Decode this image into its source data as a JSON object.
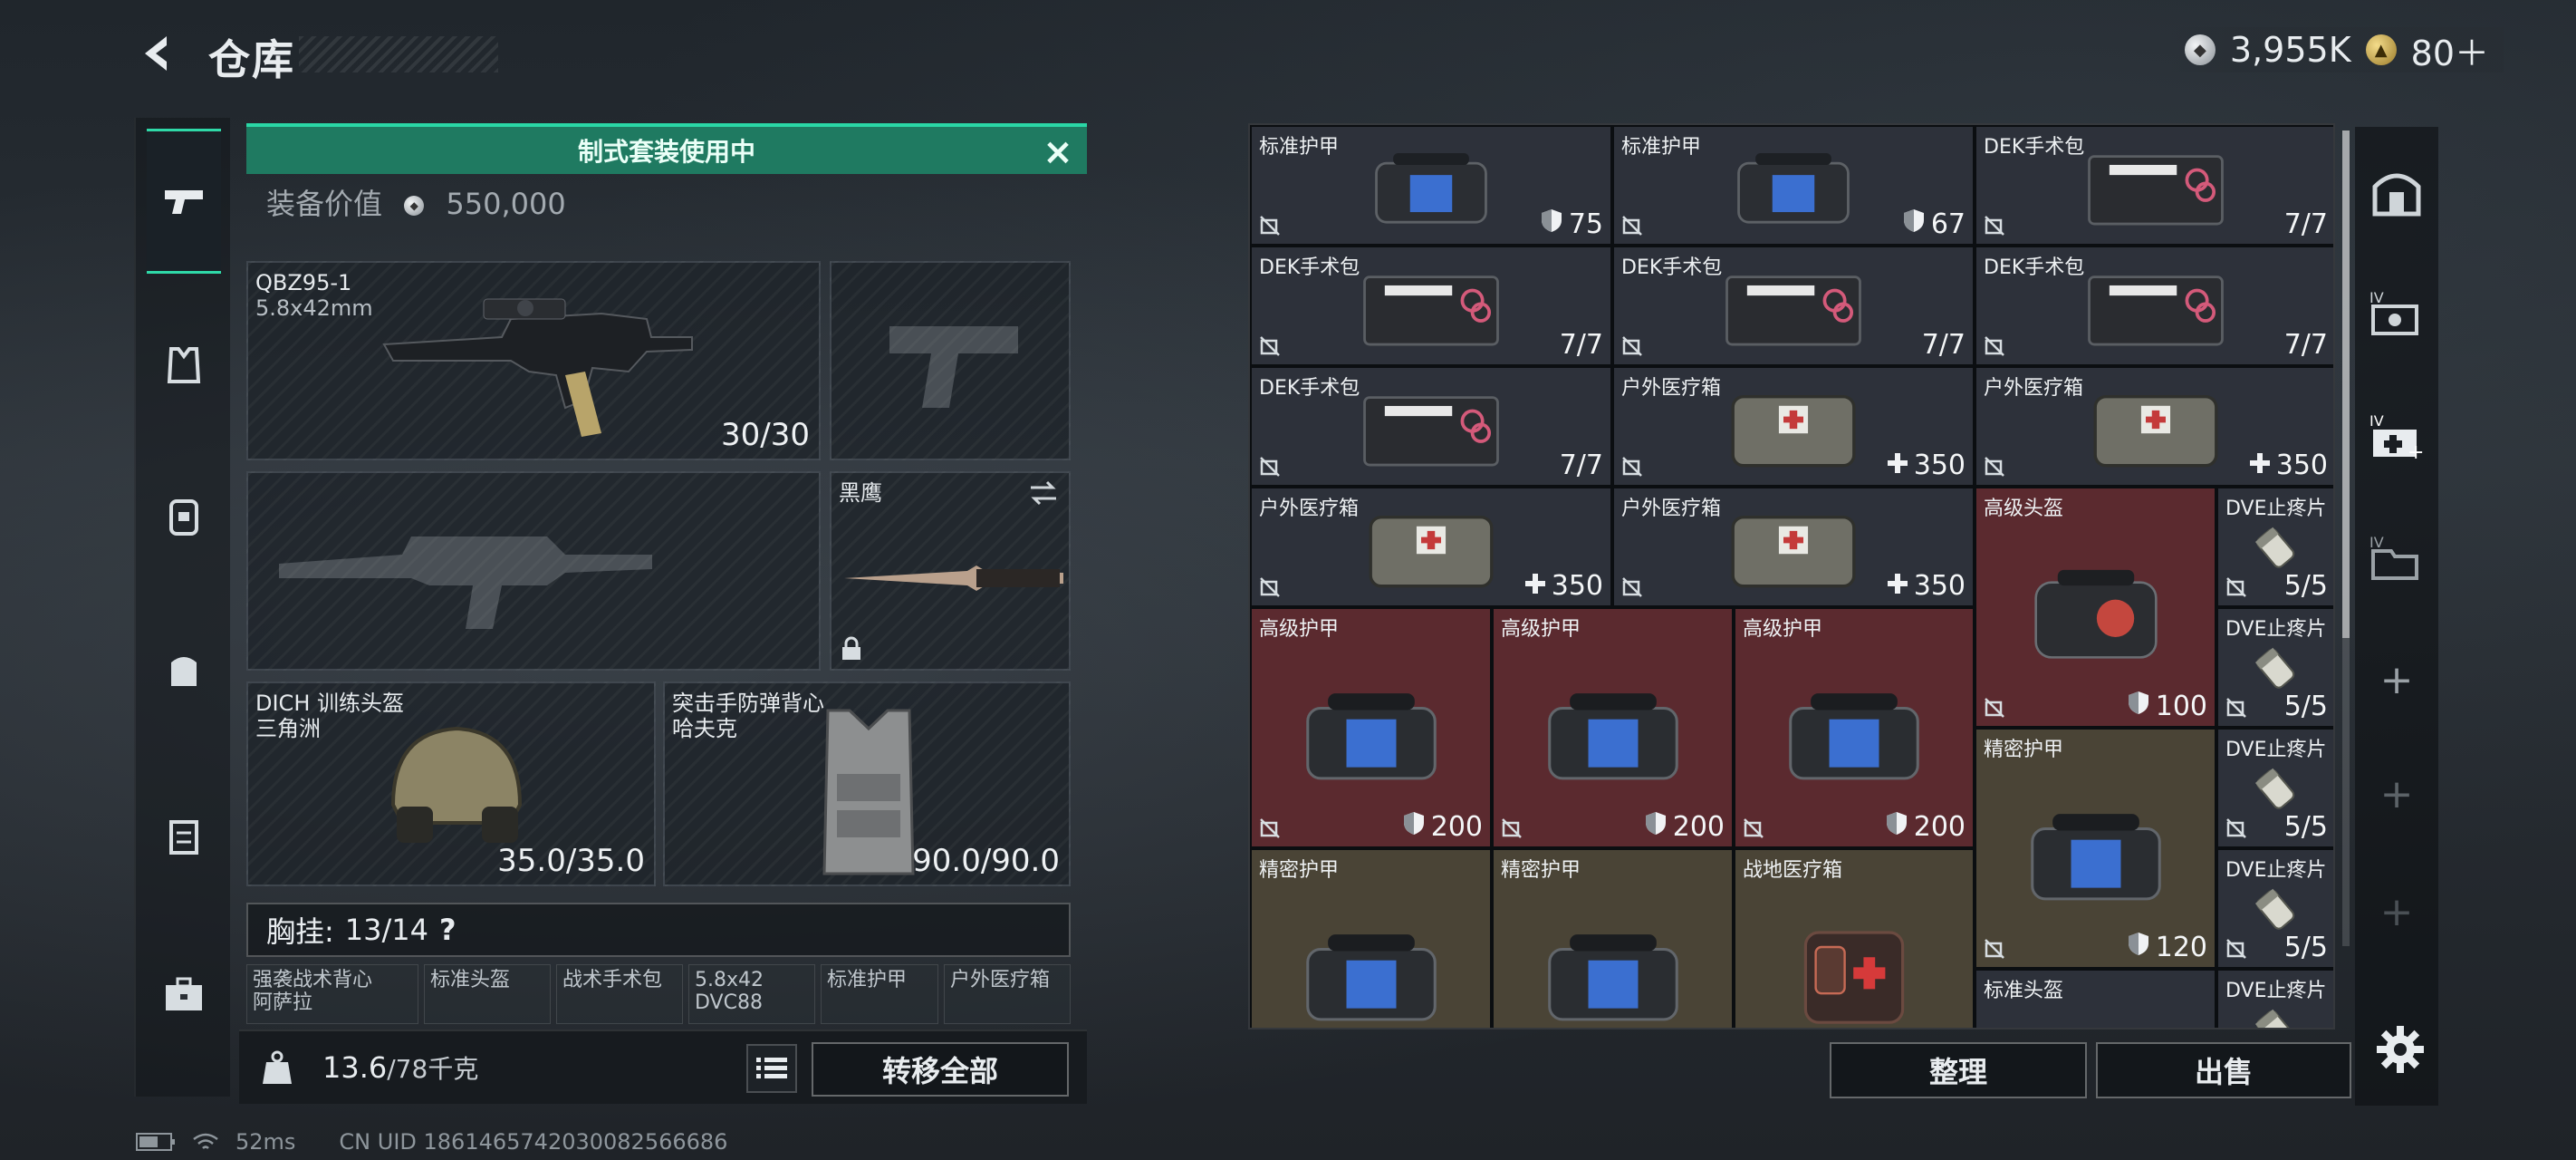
{
  "header": {
    "title": "仓库",
    "currency_a": "3,955K",
    "currency_b": "80＋"
  },
  "left_panel": {
    "kit_banner": "制式套装使用中",
    "value_label": "装备价值",
    "value": "550,000",
    "primary_weapon": {
      "name": "QBZ95-1",
      "caliber": "5.8x42mm",
      "ammo": "30/30"
    },
    "melee": {
      "name": "黑鹰"
    },
    "helmet": {
      "name": "DICH 训练头盔",
      "sub": "三角洲",
      "durability": "35.0/35.0"
    },
    "armor": {
      "name": "突击手防弹背心",
      "sub": "哈夫克",
      "durability": "90.0/90.0"
    },
    "chest_rig": {
      "label": "胸挂:",
      "capacity": "13/14",
      "help": "?"
    },
    "chips": [
      "强袭战术背心\n阿萨拉",
      "标准头盔",
      "战术手术包",
      "5.8x42\nDVC88",
      "标准护甲",
      "户外医疗箱"
    ],
    "weight": {
      "value": "13.6",
      "max": "/78千克"
    },
    "move_all_label": "转移全部"
  },
  "status_bar": {
    "ping": "52ms",
    "uid": "CN UID 1861465742030082566686"
  },
  "right_grid": {
    "cells": [
      {
        "name": "标准护甲",
        "value": "75"
      },
      {
        "name": "标准护甲",
        "value": "67"
      },
      {
        "name": "DEK手术包",
        "value": "7/7"
      },
      {
        "name": "DEK手术包",
        "value": "7/7"
      },
      {
        "name": "DEK手术包",
        "value": "7/7"
      },
      {
        "name": "DEK手术包",
        "value": "7/7"
      },
      {
        "name": "DEK手术包",
        "value": "7/7"
      },
      {
        "name": "户外医疗箱",
        "value": "350"
      },
      {
        "name": "户外医疗箱",
        "value": "350"
      },
      {
        "name": "户外医疗箱",
        "value": "350"
      },
      {
        "name": "户外医疗箱",
        "value": "350"
      },
      {
        "name": "高级头盔",
        "value": "100"
      },
      {
        "name": "DVE止疼片",
        "value": "5/5"
      },
      {
        "name": "DVE止疼片",
        "value": "5/5"
      },
      {
        "name": "高级护甲",
        "value": "200"
      },
      {
        "name": "高级护甲",
        "value": "200"
      },
      {
        "name": "高级护甲",
        "value": "200"
      },
      {
        "name": "精密护甲",
        "value": "120"
      },
      {
        "name": "DVE止疼片",
        "value": "5/5"
      },
      {
        "name": "DVE止疼片",
        "value": "5/5"
      },
      {
        "name": "精密护甲",
        "value": ""
      },
      {
        "name": "精密护甲",
        "value": ""
      },
      {
        "name": "战地医疗箱",
        "value": ""
      },
      {
        "name": "标准头盔",
        "value": ""
      },
      {
        "name": "DVE止疼片",
        "value": ""
      }
    ]
  },
  "actions": {
    "sort_label": "整理",
    "sell_label": "出售"
  },
  "colors": {
    "accent": "#2fd9a8",
    "banner": "#1f7a61",
    "cell_gray": "#2d313a",
    "cell_red": "#5b2a2f",
    "cell_olive": "#4a4436"
  }
}
